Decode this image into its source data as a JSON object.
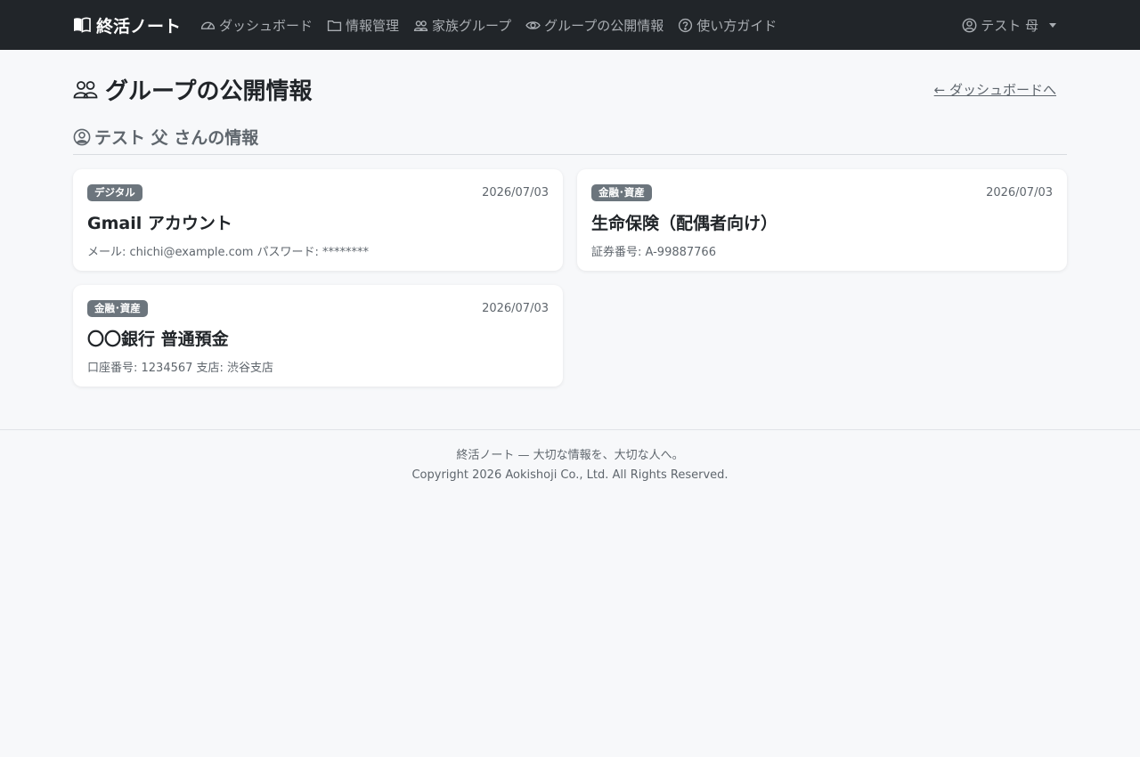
{
  "navbar": {
    "brand": "終活ノート",
    "links": [
      {
        "label": "ダッシュボード",
        "icon": "speedometer-icon"
      },
      {
        "label": "情報管理",
        "icon": "folder-icon"
      },
      {
        "label": "家族グループ",
        "icon": "people-icon"
      },
      {
        "label": "グループの公開情報",
        "icon": "eye-icon"
      },
      {
        "label": "使い方ガイド",
        "icon": "question-circle-icon"
      }
    ],
    "user": "テスト 母"
  },
  "page": {
    "title": "グループの公開情報",
    "back_link": "← ダッシュボードへ"
  },
  "section": {
    "title": "テスト 父 さんの情報"
  },
  "cards": [
    {
      "badge": "デジタル",
      "date": "2026/07/03",
      "title": "Gmail アカウント",
      "detail": "メール: chichi@example.com パスワード: ********"
    },
    {
      "badge": "金融･資産",
      "date": "2026/07/03",
      "title": "生命保険（配偶者向け）",
      "detail": "証券番号: A-99887766"
    },
    {
      "badge": "金融･資産",
      "date": "2026/07/03",
      "title": "〇〇銀行 普通預金",
      "detail": "口座番号: 1234567 支店: 渋谷支店"
    }
  ],
  "footer": {
    "line1": "終活ノート — 大切な情報を、大切な人へ。",
    "line2": "Copyright 2026 Aokishoji Co., Ltd. All Rights Reserved."
  },
  "colors": {
    "navbar_bg": "#212529",
    "page_bg": "#f7f8fa",
    "badge_bg": "#6c757d",
    "muted_text": "#5f666d"
  }
}
